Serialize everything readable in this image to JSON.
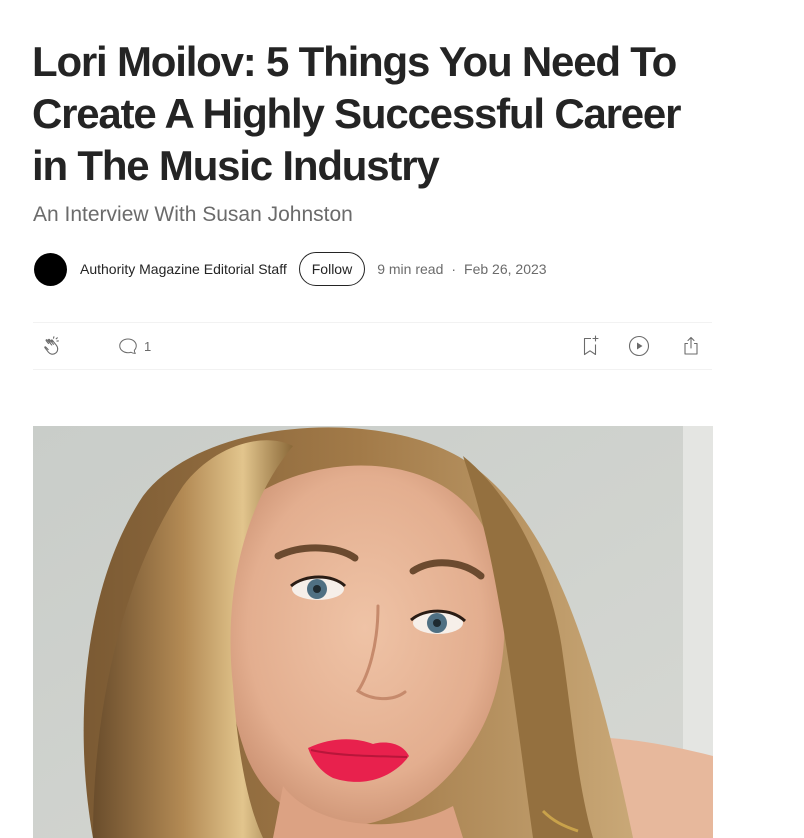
{
  "article": {
    "title": "Lori Moilov: 5 Things You Need To Create A Highly Successful Career in The Music Industry",
    "subtitle": "An Interview With Susan Johnston"
  },
  "byline": {
    "author": "Authority Magazine Editorial Staff",
    "follow_label": "Follow",
    "read_time": "9 min read",
    "separator": "·",
    "date": "Feb 26, 2023"
  },
  "actions": {
    "clap_icon": "clap-icon",
    "response_icon": "speech-bubble-icon",
    "response_count": "1",
    "save_icon": "bookmark-add-icon",
    "listen_icon": "play-circle-icon",
    "share_icon": "share-icon"
  },
  "hero": {
    "icon": "portrait-photo"
  },
  "colors": {
    "text_primary": "#242424",
    "text_secondary": "#6b6b6b",
    "divider": "#f2f2f2",
    "lipstick": "#e8214d"
  }
}
